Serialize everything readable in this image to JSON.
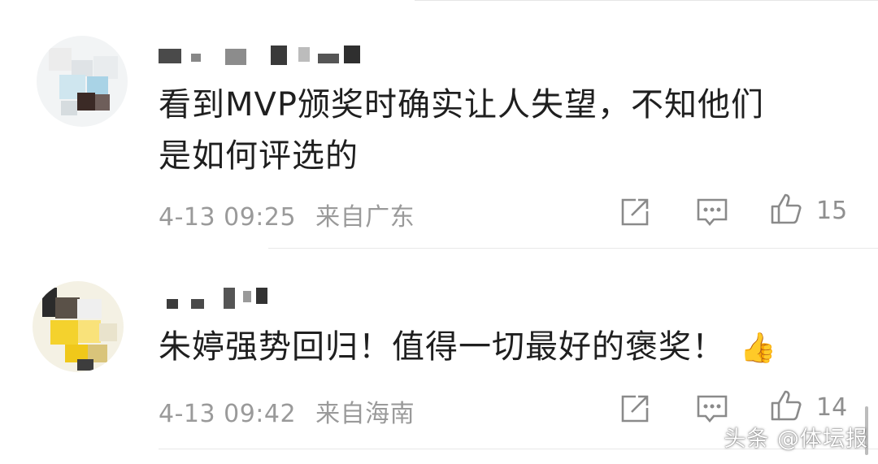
{
  "comments": [
    {
      "text_line1": "看到MVP颁奖时确实让人失望，不知他们",
      "text_line2": "是如何评选的",
      "emoji": "",
      "date": "4-13 09:25",
      "location": "来自广东",
      "likes": "15"
    },
    {
      "text_line1": "朱婷强势回归！值得一切最好的褒奖！",
      "text_line2": "",
      "emoji": "👍",
      "date": "4-13 09:42",
      "location": "来自海南",
      "likes": "14"
    }
  ],
  "watermark": "头条 @体坛报",
  "icons": {
    "share": "share-icon",
    "reply": "comment-icon",
    "like": "thumbs-up-icon"
  },
  "colors": {
    "text": "#1f1f1f",
    "meta": "#9a9a9a",
    "icon": "#8a8a8a"
  }
}
